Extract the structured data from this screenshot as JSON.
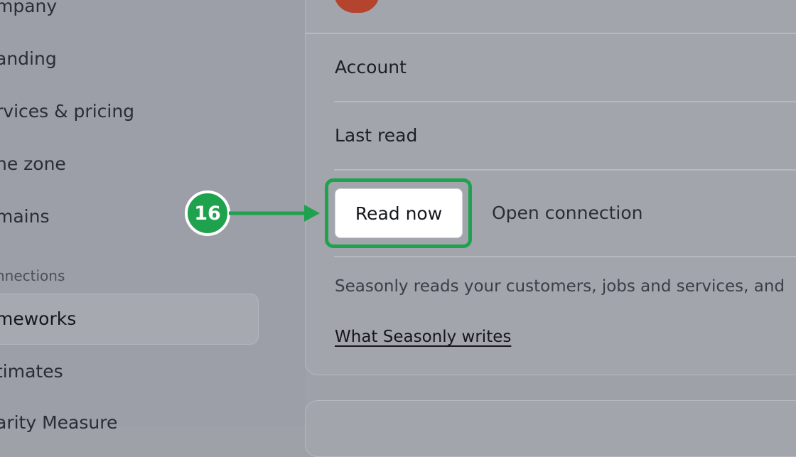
{
  "sidebar": {
    "items": [
      {
        "label": "mpany"
      },
      {
        "label": "anding"
      },
      {
        "label": "rvices & pricing"
      },
      {
        "label": "ne zone"
      },
      {
        "label": "mains"
      }
    ],
    "section_label": "nnections",
    "active_item": "meworks",
    "items_after": [
      {
        "label": "timates"
      },
      {
        "label": "arity Measure"
      }
    ]
  },
  "main": {
    "rows": {
      "account_label": "Account",
      "last_read_label": "Last read"
    },
    "read_now_label": "Read now",
    "open_connection_label": "Open connection",
    "description": "Seasonly reads your customers, jobs and services, and",
    "writes_link": "What Seasonly writes"
  },
  "annotation": {
    "step_number": "16",
    "color": "#1fa24e"
  }
}
